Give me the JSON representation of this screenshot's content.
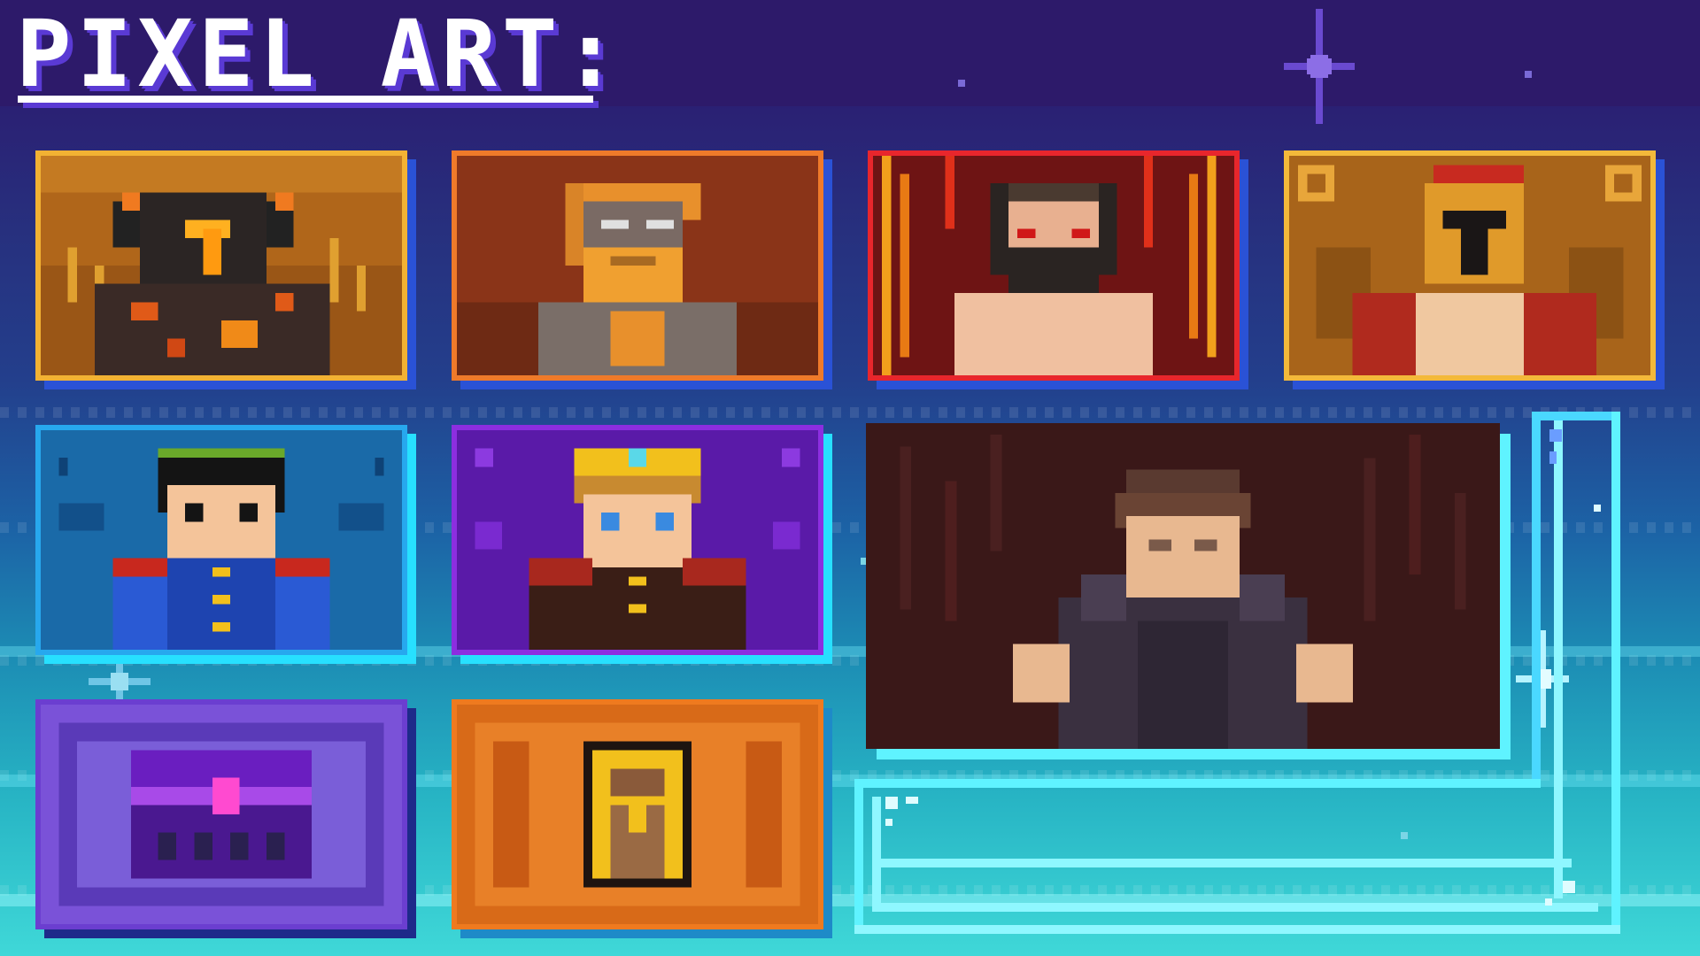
{
  "page": {
    "title": "PIXEL ART:"
  },
  "theme": {
    "bg_top": "#2e1a6c",
    "bg_bottom": "#3fd8d8",
    "title_color": "#ffffff",
    "title_shadow": "#5a3ad4"
  },
  "gallery": {
    "tiles": [
      {
        "subject": "lava-golem-portrait",
        "border": "#f2b233"
      },
      {
        "subject": "old-bearded-sage-portrait",
        "border": "#ef7a2a"
      },
      {
        "subject": "crowned-bearded-man-portrait",
        "border": "#e8262c"
      },
      {
        "subject": "spartan-warrior-portrait",
        "border": "#f3b93a"
      },
      {
        "subject": "laurel-prince-portrait",
        "border": "#27a8ee"
      },
      {
        "subject": "crowned-king-portrait",
        "border": "#8c2ee0"
      },
      {
        "subject": "dark-armored-knight-portrait",
        "border": "#5ff3ff"
      },
      {
        "subject": "purple-treasure-chest",
        "border": "#6b3ed0"
      },
      {
        "subject": "golden-treasure-chest",
        "border": "#ef7a1f"
      }
    ]
  }
}
